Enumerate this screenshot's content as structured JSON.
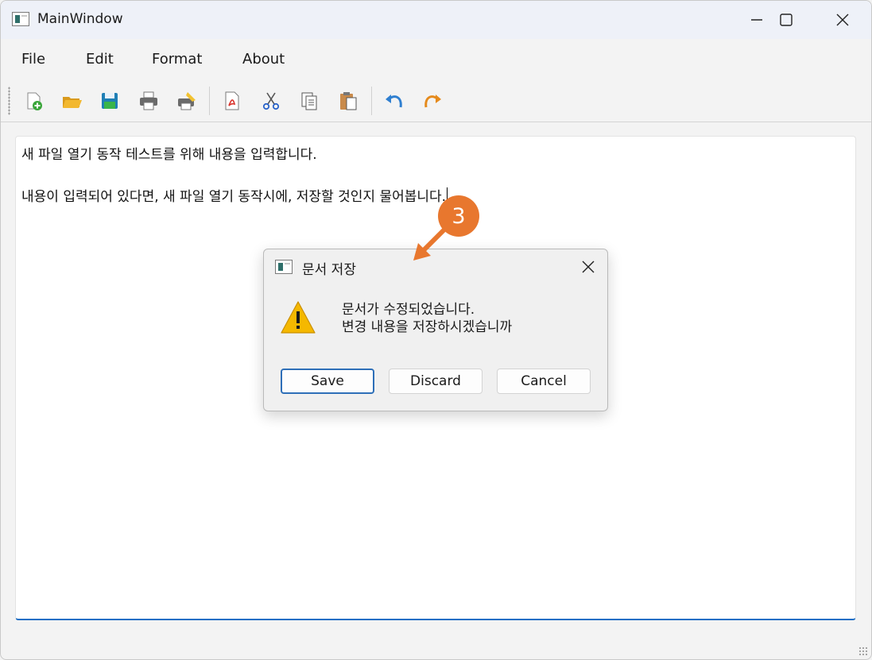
{
  "window": {
    "title": "MainWindow"
  },
  "menu": [
    {
      "label": "File"
    },
    {
      "label": "Edit"
    },
    {
      "label": "Format"
    },
    {
      "label": "About"
    }
  ],
  "toolbar": {
    "buttons": [
      {
        "icon": "new-file-icon"
      },
      {
        "icon": "open-folder-icon"
      },
      {
        "icon": "save-icon"
      },
      {
        "icon": "print-icon"
      },
      {
        "icon": "print-preview-icon"
      },
      {
        "icon": "pdf-icon"
      },
      {
        "icon": "cut-icon"
      },
      {
        "icon": "copy-icon"
      },
      {
        "icon": "paste-icon"
      },
      {
        "icon": "undo-icon"
      },
      {
        "icon": "redo-icon"
      }
    ]
  },
  "editor": {
    "line1": "새 파일 열기 동작 테스트를 위해 내용을 입력합니다.",
    "line2": "내용이 입력되어 있다면, 새 파일 열기 동작시에, 저장할 것인지 물어봅니다."
  },
  "dialog": {
    "title": "문서 저장",
    "message_line1": "문서가 수정되었습니다.",
    "message_line2": "변경 내용을 저장하시겠습니까",
    "save_label": "Save",
    "discard_label": "Discard",
    "cancel_label": "Cancel",
    "icon": "warning-icon"
  },
  "annotation": {
    "step": "3",
    "color": "#e8772e"
  },
  "colors": {
    "accent": "#1f6fc5",
    "warning": "#f5b800"
  }
}
